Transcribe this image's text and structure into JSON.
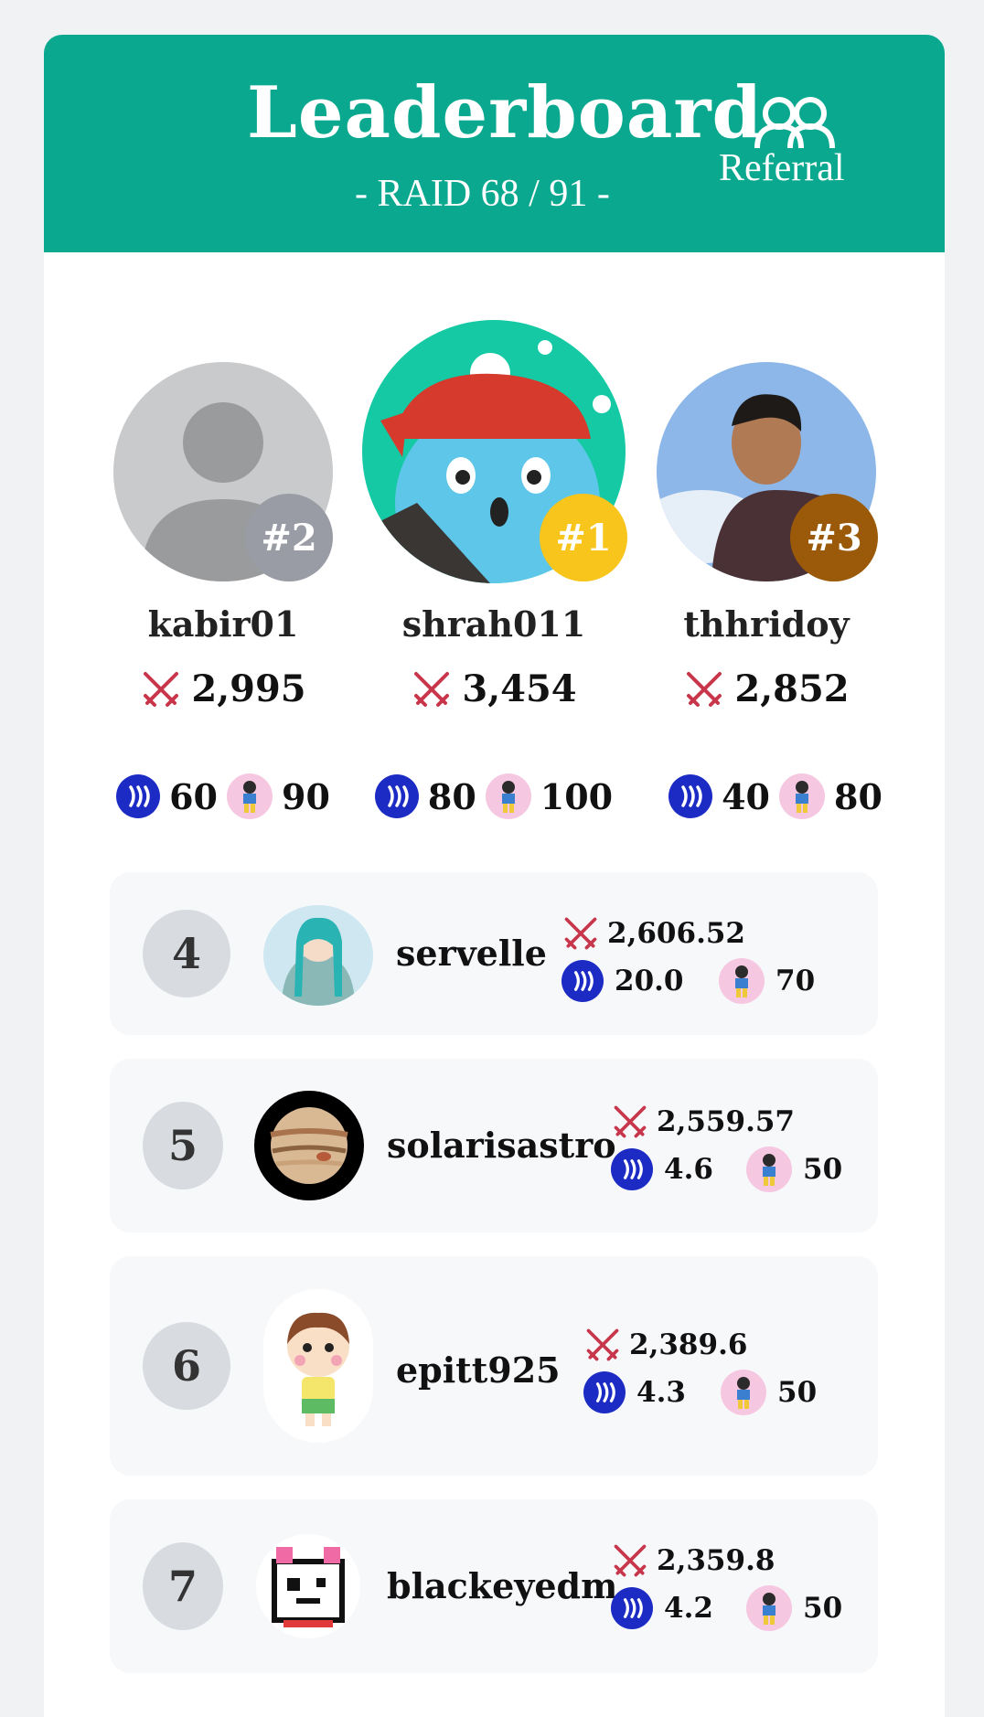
{
  "header": {
    "title": "Leaderboard",
    "subtitle": "- RAID 68 / 91 -",
    "referral_label": "Referral",
    "referral_icon": "users-icon",
    "background_color": "#0aa88f"
  },
  "podium": [
    {
      "rank_badge": "#2",
      "name": "kabir01",
      "score": "2,995",
      "steem": "60",
      "token": "90",
      "badge_color": "#9a9ca5"
    },
    {
      "rank_badge": "#1",
      "name": "shrah011",
      "score": "3,454",
      "steem": "80",
      "token": "100",
      "badge_color": "#f7c51c"
    },
    {
      "rank_badge": "#3",
      "name": "thhridoy",
      "score": "2,852",
      "steem": "40",
      "token": "80",
      "badge_color": "#9a5a0a"
    }
  ],
  "rows": [
    {
      "rank": "4",
      "name": "servelle",
      "score": "2,606.52",
      "steem": "20.0",
      "token": "70"
    },
    {
      "rank": "5",
      "name": "solarisastro",
      "score": "2,559.57",
      "steem": "4.6",
      "token": "50"
    },
    {
      "rank": "6",
      "name": "epitt925",
      "score": "2,389.6",
      "steem": "4.3",
      "token": "50"
    },
    {
      "rank": "7",
      "name": "blackeyedm",
      "score": "2,359.8",
      "steem": "4.2",
      "token": "50"
    }
  ],
  "icons": {
    "score": "crossed-swords-icon",
    "steem": "steem-icon",
    "token": "character-token-icon"
  },
  "colors": {
    "steem_blue": "#1c2bc4",
    "swords_red": "#c7364b",
    "rank_gray": "#d8dbe0"
  }
}
